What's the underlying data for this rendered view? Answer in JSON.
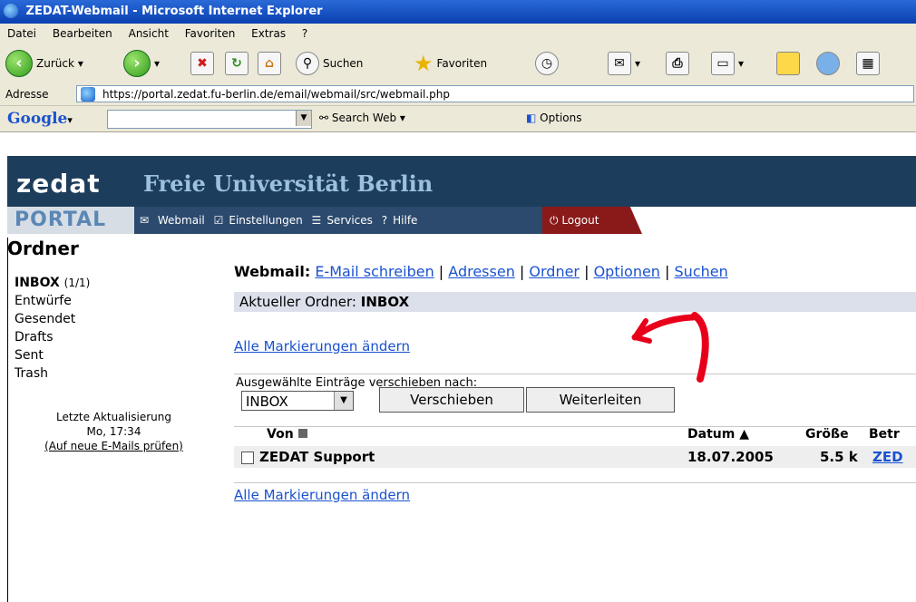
{
  "window": {
    "title": "ZEDAT-Webmail - Microsoft Internet Explorer"
  },
  "menu": [
    "Datei",
    "Bearbeiten",
    "Ansicht",
    "Favoriten",
    "Extras",
    "?"
  ],
  "toolbar": {
    "back": "Zurück",
    "search": "Suchen",
    "favorites": "Favoriten"
  },
  "address": {
    "label": "Adresse",
    "url": "https://portal.zedat.fu-berlin.de/email/webmail/src/webmail.php"
  },
  "google": {
    "logo": "Google",
    "search_web": "Search Web",
    "options": "Options"
  },
  "site": {
    "brand": "zedat",
    "university": "Freie Universität Berlin",
    "portal": "PORTAL",
    "nav": [
      "Webmail",
      "Einstellungen",
      "Services",
      "Hilfe"
    ],
    "logout": "Logout"
  },
  "folders": {
    "title": "Ordner",
    "inbox_label": "INBOX",
    "inbox_count": "(1/1)",
    "items": [
      "Entwürfe",
      "Gesendet",
      "Drafts",
      "Sent",
      "Trash"
    ],
    "last_update_label": "Letzte Aktualisierung",
    "last_update_time": "Mo, 17:34",
    "check_mail": "(Auf neue E-Mails prüfen)"
  },
  "main": {
    "webmail_label": "Webmail:",
    "links": [
      "E-Mail schreiben",
      "Adressen",
      "Ordner",
      "Optionen",
      "Suchen"
    ],
    "current_folder_label": "Aktueller Ordner:",
    "current_folder": "INBOX",
    "change_all": "Alle Markierungen ändern",
    "move_label": "Ausgewählte Einträge verschieben nach:",
    "move_select": "INBOX",
    "move_button": "Verschieben",
    "forward_button": "Weiterleiten",
    "col_from": "Von",
    "col_date": "Datum",
    "col_size": "Größe",
    "col_subject": "Betr",
    "row": {
      "from": "ZEDAT Support",
      "date": "18.07.2005",
      "size": "5.5 k",
      "subject": "ZED"
    }
  }
}
